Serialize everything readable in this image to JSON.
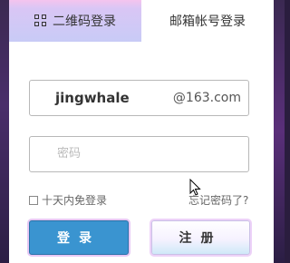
{
  "tabs": {
    "qr_label": "二维码登录",
    "mail_label": "邮箱帐号登录"
  },
  "login_form": {
    "username_value": "jingwhale",
    "username_suffix": "@163.com",
    "password_placeholder": "密码",
    "remember_label": "十天内免登录",
    "forgot_label": "忘记密码了?",
    "login_button": "登录",
    "register_button": "注册"
  },
  "icons": {
    "qr": "qr-code-icon",
    "checkbox": "checkbox-icon",
    "cursor": "mouse-cursor-icon"
  },
  "colors": {
    "login_button": "#3a94d0",
    "active_tab_tint": "#c8cbf6"
  }
}
